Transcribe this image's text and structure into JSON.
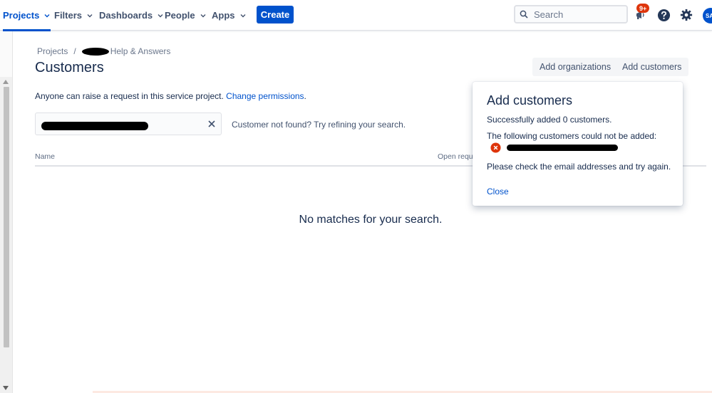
{
  "nav": {
    "projects": "Projects",
    "filters": "Filters",
    "dashboards": "Dashboards",
    "people": "People",
    "apps": "Apps",
    "create": "Create",
    "search_placeholder": "Search",
    "notification_count": "9+",
    "avatar_initials": "SA"
  },
  "breadcrumb": {
    "root": "Projects",
    "separator": "/",
    "project_suffix": "Help & Answers"
  },
  "page": {
    "title": "Customers",
    "add_organizations": "Add organizations",
    "add_customers": "Add customers",
    "info_text": "Anyone can raise a request in this service project.",
    "info_link": "Change permissions",
    "info_period": ".",
    "not_found": "Customer not found? Try refining your search.",
    "columns": {
      "name": "Name",
      "open_requests": "Open reque"
    },
    "empty_message": "No matches for your search."
  },
  "dialog": {
    "title": "Add customers",
    "success_text": "Successfully added 0 customers.",
    "failure_text": "The following customers could not be added:",
    "hint_text": "Please check the email addresses and try again.",
    "close_label": "Close"
  },
  "colors": {
    "brand": "#0052cc",
    "error": "#de350b",
    "text": "#172b4d",
    "subtle": "#6b778c"
  }
}
